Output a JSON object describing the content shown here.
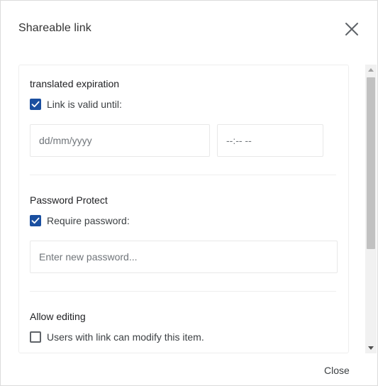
{
  "dialog": {
    "title": "Shareable link",
    "close_icon": "close-icon",
    "footer_close_label": "Close"
  },
  "expiration": {
    "title": "translated expiration",
    "checkbox_label": "Link is valid until:",
    "checked": true,
    "date_placeholder": "dd/mm/yyyy",
    "time_placeholder": "--:-- --"
  },
  "password": {
    "title": "Password Protect",
    "checkbox_label": "Require password:",
    "checked": true,
    "input_placeholder": "Enter new password..."
  },
  "editing": {
    "title": "Allow editing",
    "checkbox_label": "Users with link can modify this item.",
    "checked": false
  },
  "colors": {
    "accent": "#1a4fa0",
    "text": "#202124",
    "muted": "#70757a"
  }
}
